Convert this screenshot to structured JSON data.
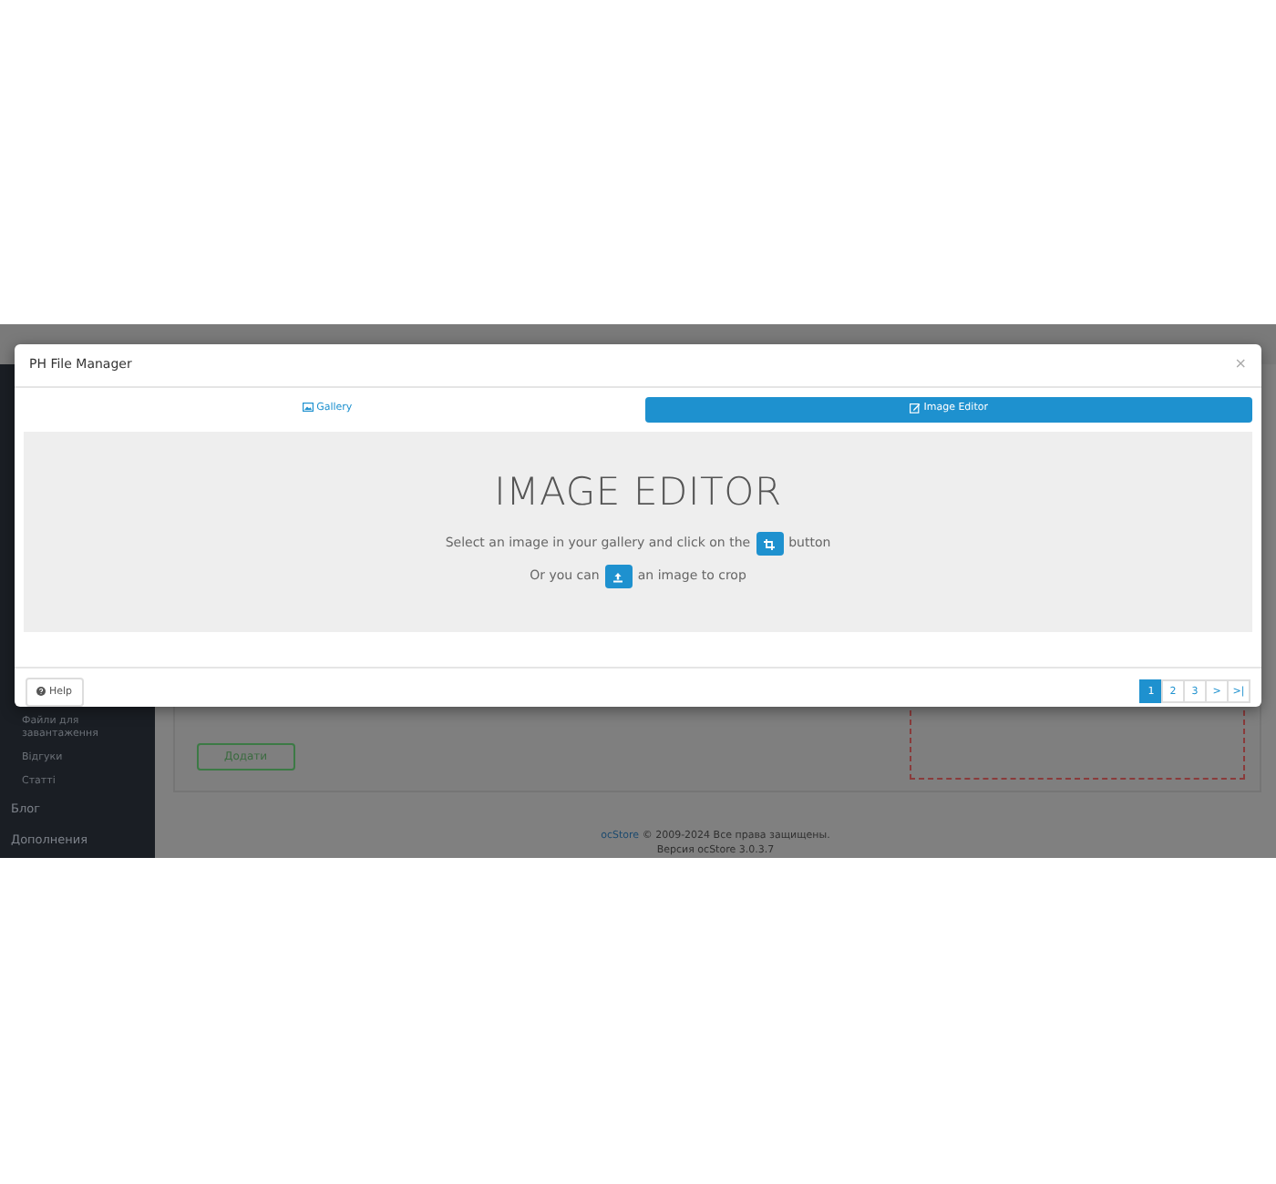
{
  "modal": {
    "title": "PH File Manager",
    "close": "×",
    "tabs": [
      {
        "label": "Gallery",
        "kind": "gallery",
        "selected": false
      },
      {
        "label": "Image Editor",
        "kind": "editor",
        "selected": true
      }
    ],
    "editor": {
      "heading": "IMAGE EDITOR",
      "line1_before": "Select an image in your gallery and click on the",
      "line1_after": "button",
      "line2_before": "Or you can",
      "line2_after": "an image to crop"
    },
    "help": "Help",
    "pages": [
      {
        "label": "1",
        "selected": true
      },
      {
        "label": "2",
        "selected": false
      },
      {
        "label": "3",
        "selected": false
      },
      {
        "label": ">",
        "selected": false
      },
      {
        "label": ">|",
        "selected": false
      }
    ]
  },
  "background": {
    "sidebar": [
      {
        "label": "Файли для завантаження",
        "kind": "sub"
      },
      {
        "label": "Відгуки",
        "kind": "sub"
      },
      {
        "label": "Статті",
        "kind": "sub"
      },
      {
        "label": "Блог",
        "kind": "main"
      },
      {
        "label": "Дополнения",
        "kind": "main"
      }
    ],
    "add_button": "Додати",
    "footer_link": "ocStore",
    "footer_text": "© 2009-2024 Все права защищены.",
    "footer_version": "Версия ocStore 3.0.3.7"
  }
}
